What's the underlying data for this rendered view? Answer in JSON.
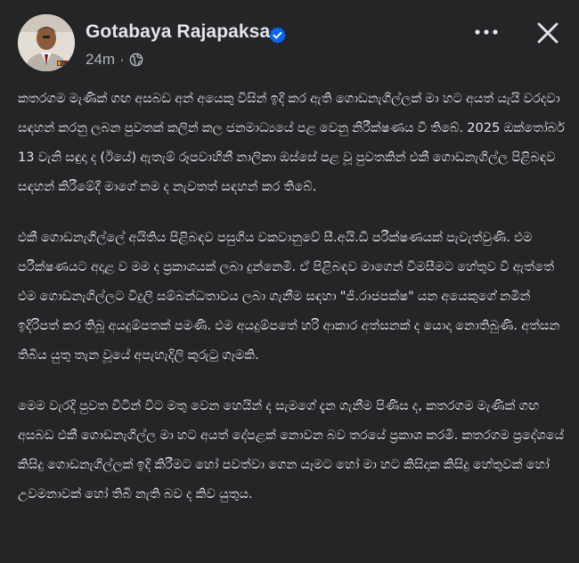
{
  "post": {
    "author": "Gotabaya Rajapaksa",
    "verified": true,
    "time": "24m",
    "separator": "·",
    "audience_icon": "globe-icon",
    "paragraphs": [
      "කතරගම මැණික් ගඟ අසබඩ අන් අයෙකු විසින් ඉදි කර ඇති ගොඩනැගිල්ලක් මා හට අයත් යැයි වරදවා සඳහන් කරනු ලබන පුවතක් කලින් කල ජනමාධ්‍යයේ පළ වෙනු නිරීක්ෂණය වී තිබේ. 2025 ඔක්තෝබර් 13 වැනි සඳුදා ද (ඊයේ) ඇතැම් රූපවාහිනී නාලිකා ඔස්සේ පළ වූ පුවතකින් එකී ගොඩනැගිල්ල පිළිබඳව සඳහන් කිරීමේදී මාගේ නම ද නැවතත් සඳහන් කර තිබේ.",
      "එකී ගොඩනැගිල්ලේ අයිතිය පිළිබඳව පසුගිය වකවානුවේ සී.අයි.ඩී පරීක්ෂණයක් පැවැත්වුණි. එම පරීක්ෂණයට අදාළ ව මම ද ප්‍රකාශයක් ලබා දුන්නෙමි. ඒ පිළිබඳව මාගෙන් විමසීමට හේතුව වී ඇත්තේ එම ගොඩනැගිල්ලට විදුලි සම්බන්ධතාවය ලබා ගැනීම සඳහා \"ජී.රාජපක්ෂ\" යන අයෙකුගේ නමින් ඉදිරිපත් කර තිබූ අයදුම්පතක් පමණි. එම අයදුම්පතේ හරි ආකාර අත්සනක් ද යොදා නොතිබුණි. අත්සන තිබිය යුතු තැන වූයේ අපැහැදිලි කුරුටු ගෑමකි.",
      "මෙම වැරදි පුවත විටින් විට මතු වෙන හෙයින් ද සැමගේ දැන ගැනීම පිණිස ද, කතරගම මැණික් ගඟ අසබඩ එකී ගොඩනැගිල්ල මා හට අයත් දේපළක් නොවන බව තරයේ ප්‍රකාශ කරමි. කතරගම ප්‍රදේශයේ කිසිදු ගොඩනැගිල්ලක් ඉදි කිරීමට හෝ පවත්වා ගෙන යෑමට හෝ මා හට කිසිදාක කිසිදු හේතුවක් හෝ උවමනාවක් හෝ තිබී නැති බව ද කිව යුතුය."
    ]
  },
  "icons": {
    "more": "more-options-icon",
    "close": "close-icon"
  },
  "colors": {
    "background": "#242526",
    "text": "#e4e6eb",
    "secondary_text": "#b0b3b8",
    "verified_badge": "#0866ff"
  }
}
